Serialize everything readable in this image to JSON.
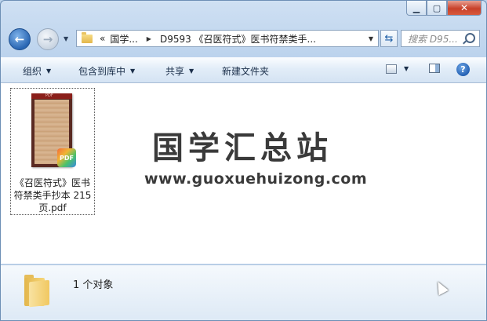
{
  "window": {
    "caption_buttons": {
      "minimize": "▁",
      "maximize": "▢",
      "close": "✕"
    }
  },
  "nav": {
    "breadcrumb_prefix": "«",
    "breadcrumbs": [
      "国学...",
      "D9593 《召医符式》医书符禁类手..."
    ],
    "search_placeholder": "搜索 D95..."
  },
  "toolbar": {
    "organize": "组织",
    "include_in_library": "包含到库中",
    "share": "共享",
    "new_folder": "新建文件夹"
  },
  "content": {
    "files": [
      {
        "name": "《召医符式》医书符禁类手抄本 215页.pdf",
        "badge": "PDF",
        "thumb_tag": "PDF"
      }
    ],
    "watermark_title": "国学汇总站",
    "watermark_url": "www.guoxuehuizong.com"
  },
  "details": {
    "status": "1 个对象"
  },
  "colors": {
    "accent": "#1f5cb0",
    "close": "#c8402a",
    "folder": "#f1c861"
  }
}
